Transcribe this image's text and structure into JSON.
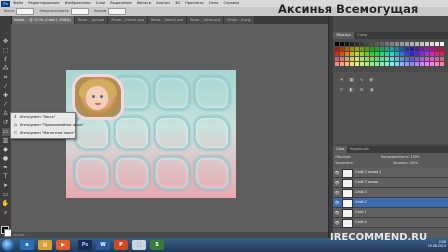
{
  "watermark_title": "Аксинья Всемогущая",
  "recommend_watermark": "IRECOMMEND.RU",
  "menubar": {
    "app_badge": "Ps",
    "items": [
      "Файл",
      "Редактирование",
      "Изображение",
      "Слои",
      "Выделение",
      "Фильтр",
      "Анализ",
      "3D",
      "Просмотр",
      "Окно",
      "Справка"
    ]
  },
  "options": {
    "items": [
      "Кисть",
      "Непрозрачность",
      "Нажим"
    ]
  },
  "tabs": [
    "Mobile ... @ 33,3% (Слой 2, RGB/8)",
    "ffmob..._pod.psd",
    "ffmob..._frame1.png",
    "ffmob..._frame2.psd",
    "ffmob..._frame.png",
    "ffmob..._fr.png"
  ],
  "flyout": {
    "items": [
      "Инструмент \"Лассо\"",
      "Инструмент \"Прямолинейное лассо\"",
      "Инструмент \"Магнитное лассо\""
    ]
  },
  "status": "33,33%",
  "panels": {
    "top_tabs": [
      "Образцы",
      "Стили"
    ],
    "mid_tabs": [
      "Слои",
      "Коррекция"
    ],
    "blend_mode": "Обычные",
    "opacity_label": "Непрозрачность:",
    "opacity_value": "100%",
    "lock_label": "Закрепить:",
    "fill_label": "Заливка:",
    "fill_value": "100%",
    "layers": [
      {
        "name": "Слой 3 копия 2",
        "selected": false
      },
      {
        "name": "Слой 3 копия",
        "selected": false
      },
      {
        "name": "Слой 3",
        "selected": false
      },
      {
        "name": "Слой 2",
        "selected": true
      },
      {
        "name": "Слой 1",
        "selected": false
      },
      {
        "name": "Слой 4",
        "selected": false
      }
    ]
  },
  "tray": {
    "time": "2:08",
    "date": "29.08.2013"
  },
  "icons": {
    "move": "move-icon",
    "marquee": "marquee-icon",
    "lasso": "lasso-icon",
    "wand": "magic-wand-icon",
    "crop": "crop-icon",
    "eyedropper": "eyedropper-icon",
    "healing": "healing-brush-icon",
    "brush": "brush-icon",
    "stamp": "clone-stamp-icon",
    "history": "history-brush-icon",
    "eraser": "eraser-icon",
    "gradient": "gradient-icon",
    "blur": "blur-icon",
    "dodge": "dodge-icon",
    "pen": "pen-icon",
    "type": "type-icon",
    "path": "path-selection-icon",
    "shape": "shape-icon",
    "hand": "hand-icon",
    "zoom": "zoom-icon"
  }
}
